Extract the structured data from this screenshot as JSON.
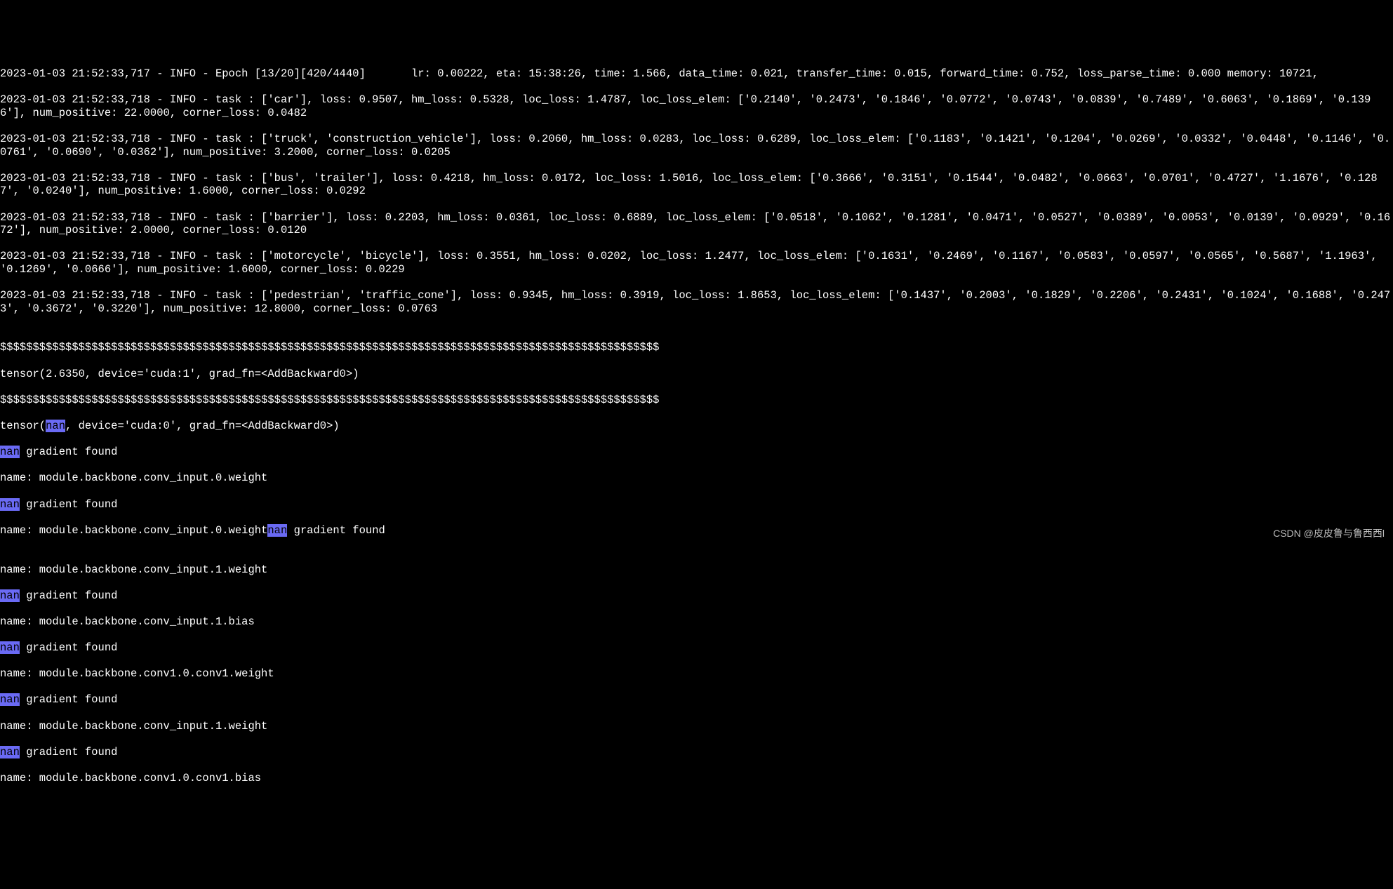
{
  "log": {
    "epoch_line": "2023-01-03 21:52:33,717 - INFO - Epoch [13/20][420/4440]       lr: 0.00222, eta: 15:38:26, time: 1.566, data_time: 0.021, transfer_time: 0.015, forward_time: 0.752, loss_parse_time: 0.000 memory: 10721,",
    "task_car": "2023-01-03 21:52:33,718 - INFO - task : ['car'], loss: 0.9507, hm_loss: 0.5328, loc_loss: 1.4787, loc_loss_elem: ['0.2140', '0.2473', '0.1846', '0.0772', '0.0743', '0.0839', '0.7489', '0.6063', '0.1869', '0.1396'], num_positive: 22.0000, corner_loss: 0.0482",
    "task_truck": "2023-01-03 21:52:33,718 - INFO - task : ['truck', 'construction_vehicle'], loss: 0.2060, hm_loss: 0.0283, loc_loss: 0.6289, loc_loss_elem: ['0.1183', '0.1421', '0.1204', '0.0269', '0.0332', '0.0448', '0.1146', '0.0761', '0.0690', '0.0362'], num_positive: 3.2000, corner_loss: 0.0205",
    "task_bus": "2023-01-03 21:52:33,718 - INFO - task : ['bus', 'trailer'], loss: 0.4218, hm_loss: 0.0172, loc_loss: 1.5016, loc_loss_elem: ['0.3666', '0.3151', '0.1544', '0.0482', '0.0663', '0.0701', '0.4727', '1.1676', '0.1287', '0.0240'], num_positive: 1.6000, corner_loss: 0.0292",
    "task_barrier": "2023-01-03 21:52:33,718 - INFO - task : ['barrier'], loss: 0.2203, hm_loss: 0.0361, loc_loss: 0.6889, loc_loss_elem: ['0.0518', '0.1062', '0.1281', '0.0471', '0.0527', '0.0389', '0.0053', '0.0139', '0.0929', '0.1672'], num_positive: 2.0000, corner_loss: 0.0120",
    "task_moto": "2023-01-03 21:52:33,718 - INFO - task : ['motorcycle', 'bicycle'], loss: 0.3551, hm_loss: 0.0202, loc_loss: 1.2477, loc_loss_elem: ['0.1631', '0.2469', '0.1167', '0.0583', '0.0597', '0.0565', '0.5687', '1.1963', '0.1269', '0.0666'], num_positive: 1.6000, corner_loss: 0.0229",
    "task_ped": "2023-01-03 21:52:33,718 - INFO - task : ['pedestrian', 'traffic_cone'], loss: 0.9345, hm_loss: 0.3919, loc_loss: 1.8653, loc_loss_elem: ['0.1437', '0.2003', '0.1829', '0.2206', '0.2431', '0.1024', '0.1688', '0.2473', '0.3672', '0.3220'], num_positive: 12.8000, corner_loss: 0.0763",
    "blank1": "",
    "dollars1": "$$$$$$$$$$$$$$$$$$$$$$$$$$$$$$$$$$$$$$$$$$$$$$$$$$$$$$$$$$$$$$$$$$$$$$$$$$$$$$$$$$$$$$$$$$$$$$$$$$$$$",
    "tensor1": "tensor(2.6350, device='cuda:1', grad_fn=<AddBackward0>)",
    "dollars2": "$$$$$$$$$$$$$$$$$$$$$$$$$$$$$$$$$$$$$$$$$$$$$$$$$$$$$$$$$$$$$$$$$$$$$$$$$$$$$$$$$$$$$$$$$$$$$$$$$$$$$",
    "tensor2_pre": "tensor(",
    "tensor2_nan": "nan",
    "tensor2_post": ", device='cuda:0', grad_fn=<AddBackward0>)",
    "nan_word": "nan",
    "grad_found": " gradient found",
    "name_w0": "name: module.backbone.conv_input.0.weight",
    "name_w0b": "name: module.backbone.conv_input.0.weight",
    "blank2": "",
    "name_w1": "name: module.backbone.conv_input.1.weight",
    "name_b1": "name: module.backbone.conv_input.1.bias",
    "name_c1w": "name: module.backbone.conv1.0.conv1.weight",
    "name_w1b": "name: module.backbone.conv_input.1.weight",
    "name_c1b": "name: module.backbone.conv1.0.conv1.bias"
  },
  "watermark": "CSDN @皮皮鲁与鲁西西l"
}
